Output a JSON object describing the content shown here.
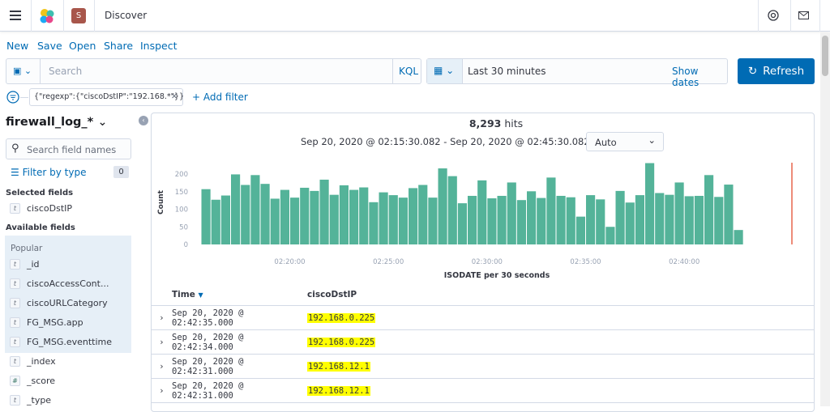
{
  "header": {
    "app_title": "Discover",
    "space_initial": "S",
    "space_color": "#a8564b"
  },
  "menu": {
    "new": "New",
    "save": "Save",
    "open": "Open",
    "share": "Share",
    "inspect": "Inspect"
  },
  "query": {
    "placeholder": "Search",
    "language": "KQL",
    "time_range": "Last 30 minutes",
    "show_dates": "Show dates",
    "refresh": "Refresh"
  },
  "filters": {
    "pill": "{\"regexp\":{\"ciscoDstIP\":\"192.168.*\"}}",
    "add_filter": "+ Add filter"
  },
  "sidebar": {
    "index_pattern": "firewall_log_*",
    "search_placeholder": "Search field names",
    "filter_by_type": "Filter by type",
    "filter_count": "0",
    "selected_title": "Selected fields",
    "selected": [
      {
        "type": "t",
        "name": "ciscoDstIP"
      }
    ],
    "available_title": "Available fields",
    "popular_title": "Popular",
    "popular": [
      {
        "type": "t",
        "name": "_id"
      },
      {
        "type": "t",
        "name": "ciscoAccessCont..."
      },
      {
        "type": "t",
        "name": "ciscoURLCategory"
      },
      {
        "type": "t",
        "name": "FG_MSG.app"
      },
      {
        "type": "t",
        "name": "FG_MSG.eventtime"
      }
    ],
    "other": [
      {
        "type": "t",
        "name": "_index"
      },
      {
        "type": "#",
        "name": "_score"
      },
      {
        "type": "t",
        "name": "_type"
      }
    ]
  },
  "results": {
    "hits": "8,293",
    "hits_label": "hits",
    "range": "Sep 20, 2020 @ 02:15:30.082 - Sep 20, 2020 @ 02:45:30.082 —",
    "interval": "Auto"
  },
  "chart_data": {
    "type": "bar",
    "xlabel": "ISODATE per 30 seconds",
    "ylabel": "Count",
    "ylim": [
      0,
      230
    ],
    "yticks": [
      0,
      50,
      100,
      150,
      200
    ],
    "xlim": [
      "02:15:30",
      "02:45:30"
    ],
    "xticks": [
      "02:20:00",
      "02:25:00",
      "02:30:00",
      "02:35:00",
      "02:40:00"
    ],
    "bar_color": "#54b399",
    "now_marker_color": "#e7664c",
    "interval_seconds": 30,
    "start": "02:15:30",
    "values": [
      157,
      127,
      139,
      199,
      169,
      197,
      172,
      130,
      155,
      133,
      161,
      152,
      184,
      141,
      168,
      155,
      162,
      120,
      148,
      140,
      133,
      160,
      169,
      133,
      216,
      194,
      117,
      138,
      182,
      131,
      138,
      176,
      126,
      151,
      132,
      190,
      138,
      134,
      79,
      140,
      128,
      50,
      152,
      119,
      140,
      231,
      146,
      141,
      176,
      137,
      138,
      197,
      135,
      170,
      41
    ]
  },
  "table": {
    "columns": [
      "Time",
      "ciscoDstIP"
    ],
    "rows": [
      [
        "Sep 20, 2020 @ 02:42:35.000",
        "192.168.0.225"
      ],
      [
        "Sep 20, 2020 @ 02:42:34.000",
        "192.168.0.225"
      ],
      [
        "Sep 20, 2020 @ 02:42:31.000",
        "192.168.12.1"
      ],
      [
        "Sep 20, 2020 @ 02:42:31.000",
        "192.168.12.1"
      ]
    ]
  }
}
